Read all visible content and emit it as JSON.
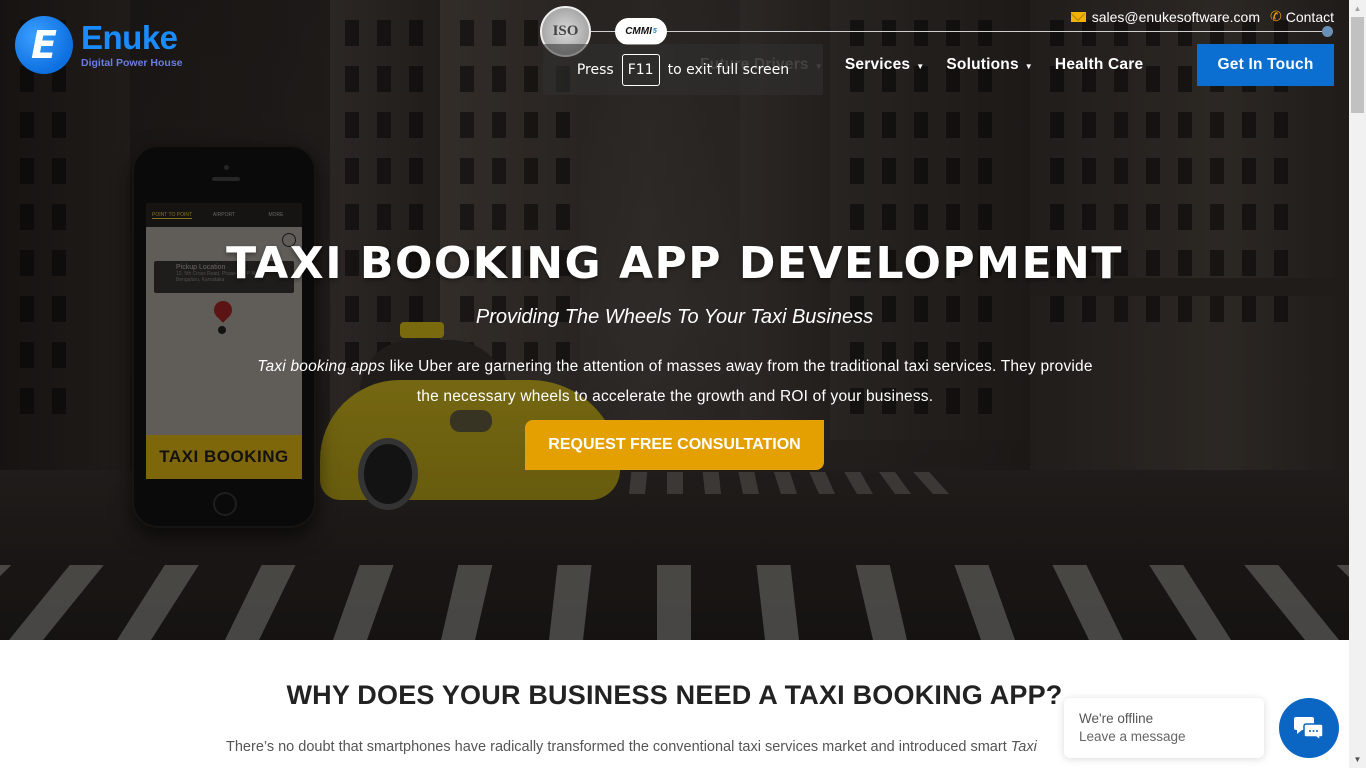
{
  "brand": {
    "name": "Enuke",
    "tagline": "Digital Power House",
    "logo_letter": "E"
  },
  "certifications": {
    "iso_label": "ISO",
    "cmmi_label": "CMMI",
    "cmmi_sub": "5"
  },
  "top_bar": {
    "email_icon": "envelope-icon",
    "email": "sales@enukesoftware.com",
    "contact_icon": "phone-icon",
    "contact_label": "Contact"
  },
  "nav": {
    "items": [
      {
        "label": "Future Drivers",
        "has_dropdown": true
      },
      {
        "label": "Services",
        "has_dropdown": true
      },
      {
        "label": "Solutions",
        "has_dropdown": true
      },
      {
        "label": "Health Care",
        "has_dropdown": false
      }
    ],
    "cta_label": "Get In Touch"
  },
  "fullscreen_toast": {
    "prefix": "Press",
    "key": "F11",
    "suffix": "to exit full screen"
  },
  "hero": {
    "title": "TAXI BOOKING APP DEVELOPMENT",
    "subtitle": "Providing The Wheels To Your Taxi Business",
    "desc_emphasis": "Taxi booking apps",
    "desc_rest": " like Uber are garnering the attention of masses away from the traditional taxi services. They provide the necessary wheels to accelerate the growth and ROI of your business.",
    "cta_label": "REQUEST FREE CONSULTATION",
    "phone_mockup": {
      "tabs": [
        "POINT TO POINT",
        "AIRPORT",
        "MORE"
      ],
      "pickup_title": "Pickup Location",
      "pickup_address": "12, 5th Cross Road, Phase 2, J P Nagar, Bengaluru, Karnataka",
      "banner": "TAXI BOOKING"
    }
  },
  "section": {
    "title": "WHY DOES YOUR BUSINESS NEED A TAXI BOOKING APP?",
    "text": "There’s no doubt that smartphones have radically transformed the conventional taxi services market and introduced smart ",
    "text_emphasis": "Taxi"
  },
  "chat": {
    "status": "We're offline",
    "action": "Leave a message",
    "icon": "chat-bubbles-icon"
  },
  "colors": {
    "brand_blue": "#1a8cff",
    "cta_blue": "#0a6fd1",
    "cta_gold": "#e3a000",
    "chat_blue": "#0a66c2"
  }
}
